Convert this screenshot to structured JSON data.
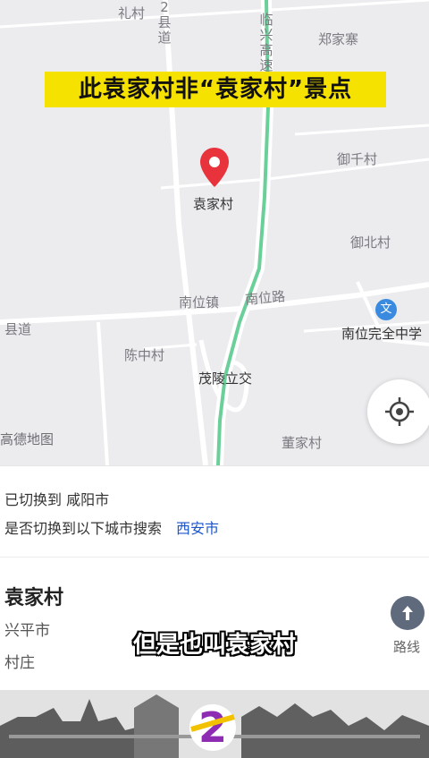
{
  "banner": {
    "title": "此袁家村非“袁家村”景点"
  },
  "map": {
    "pin_label": "袁家村",
    "labels": {
      "lizhuang": "礼村",
      "zhengjiazhai": "郑家寨",
      "yuqiancun": "御千村",
      "yubeicun": "御北村",
      "nanweizhen": "南位镇",
      "nanweilu": "南位路",
      "xiandao": "县道",
      "chenzhongcun": "陈中村",
      "maolinglijiao": "茂陵立交",
      "nanwei_school": "南位完全中学",
      "dongjiacun": "董家村",
      "vertical_road_1": "2县道",
      "vertical_road_2": "临兴高速"
    },
    "school_icon_char": "文",
    "watermark": "高德地图"
  },
  "city_notice": {
    "switched_prefix": "已切换到",
    "switched_city": "咸阳市",
    "ask_text": "是否切换到以下城市搜索",
    "alt_city": "西安市"
  },
  "poi": {
    "name": "袁家村",
    "city": "兴平市",
    "category": "村庄",
    "route_label": "路线"
  },
  "subtitle": "但是也叫袁家村",
  "colors": {
    "banner_bg": "#f6e200",
    "pin": "#e8333c",
    "link": "#1a55c9",
    "highway": "#6bcf9a"
  },
  "icons": {
    "pin": "location-pin-icon",
    "locate": "crosshair-locate-icon",
    "route": "route-arrow-icon",
    "school": "school-icon"
  }
}
